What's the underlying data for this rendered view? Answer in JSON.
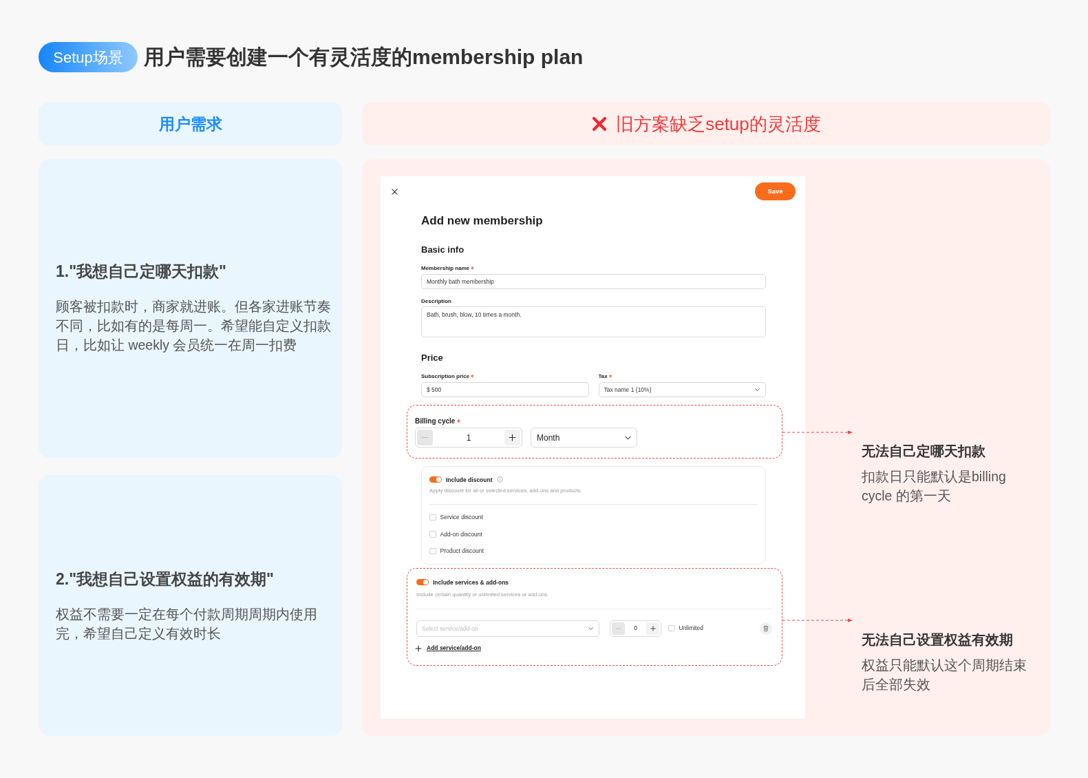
{
  "header": {
    "tag": "Setup场景",
    "title": "用户需要创建一个有灵活度的membership plan"
  },
  "user_needs": {
    "title": "用户需求",
    "items": [
      {
        "title": "1.\"我想自己定哪天扣款\"",
        "body": "顾客被扣款时，商家就进账。但各家进账节奏不同，比如有的是每周一。希望能自定义扣款日，比如让 weekly 会员统一在周一扣费"
      },
      {
        "title": "2.\"我想自己设置权益的有效期\"",
        "body": "权益不需要一定在每个付款周期周期内使用完，希望自己定义有效时长"
      }
    ]
  },
  "old_design": {
    "title": "旧方案缺乏setup的灵活度",
    "form": {
      "save_button": "Save",
      "title": "Add new membership",
      "basic_info": {
        "heading": "Basic info",
        "fields": [
          {
            "label": "Membership name",
            "required": true,
            "kind": "text",
            "value": "Monthly bath membership"
          },
          {
            "label": "Description",
            "required": false,
            "kind": "textarea",
            "value": "Bath, brush, blow, 10 times a month."
          }
        ]
      },
      "price": {
        "heading": "Price",
        "fields": [
          {
            "label": "Subscription price",
            "required": true,
            "kind": "text",
            "value": "$ 500"
          },
          {
            "label": "Tax",
            "required": true,
            "kind": "select",
            "value": "Tax name 1 (10%)"
          }
        ]
      },
      "billing_cycle": {
        "label": "Billing cycle",
        "required": true,
        "highlighted": true,
        "quantity": "1",
        "decrement_disabled": true,
        "unit": "Month"
      },
      "discount": {
        "label": "Include discount",
        "on": true,
        "description": "Apply discount for all or selected services, add-ons and products.",
        "options": [
          {
            "label": "Service discount",
            "checked": false
          },
          {
            "label": "Add-on discount",
            "checked": false
          },
          {
            "label": "Product discount",
            "checked": false
          }
        ]
      },
      "services": {
        "label": "Include services & add-ons",
        "on": true,
        "highlighted": true,
        "description": "Include certain quantity or unlimited services or add-ons.",
        "rows": [
          {
            "placeholder": "Select service/add-on",
            "quantity": "0",
            "decrement_disabled": true,
            "unlimited_label": "Unlimited",
            "unlimited": false
          }
        ],
        "add_link": "Add service/add-on"
      }
    },
    "annotations": [
      {
        "title": "无法自己定哪天扣款",
        "body": "扣款日只能默认是billing cycle 的第一天"
      },
      {
        "title": "无法自己设置权益有效期",
        "body": "权益只能默认这个周期结束后全部失效"
      }
    ]
  }
}
